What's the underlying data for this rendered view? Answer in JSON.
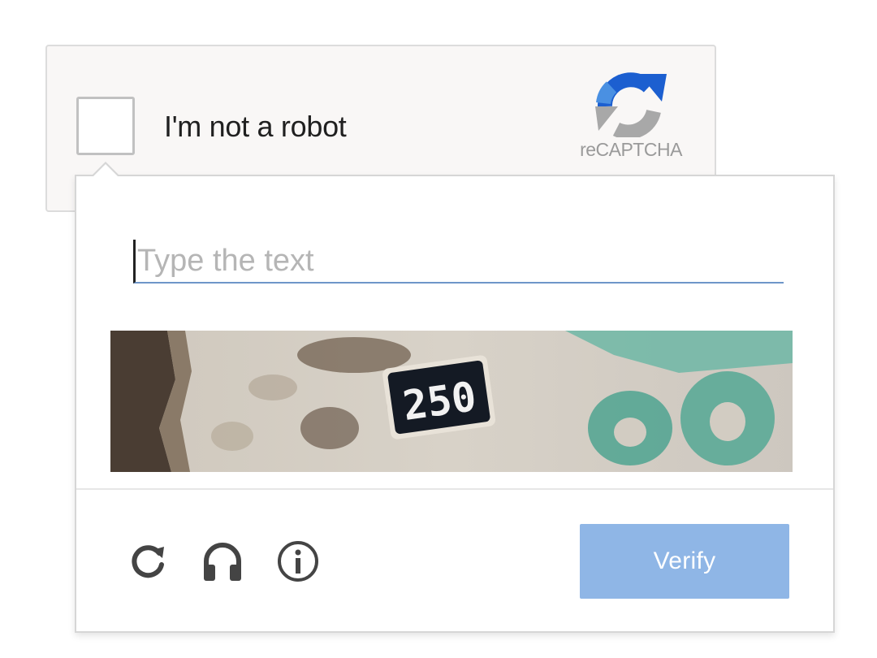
{
  "anchor": {
    "label": "I'm not a robot",
    "logo_text": "reCAPTCHA",
    "logo_icon": "recaptcha-logo-icon"
  },
  "challenge": {
    "input_placeholder": "Type the text",
    "input_value": "",
    "image_text": "250",
    "reload_icon": "reload-icon",
    "audio_icon": "headphones-icon",
    "info_icon": "info-icon",
    "verify_label": "Verify"
  },
  "colors": {
    "verify_button": "#8fb6e6",
    "input_underline": "#6e96c9",
    "logo_blue": "#1c5fd0",
    "logo_gray": "#a8a8a8"
  }
}
